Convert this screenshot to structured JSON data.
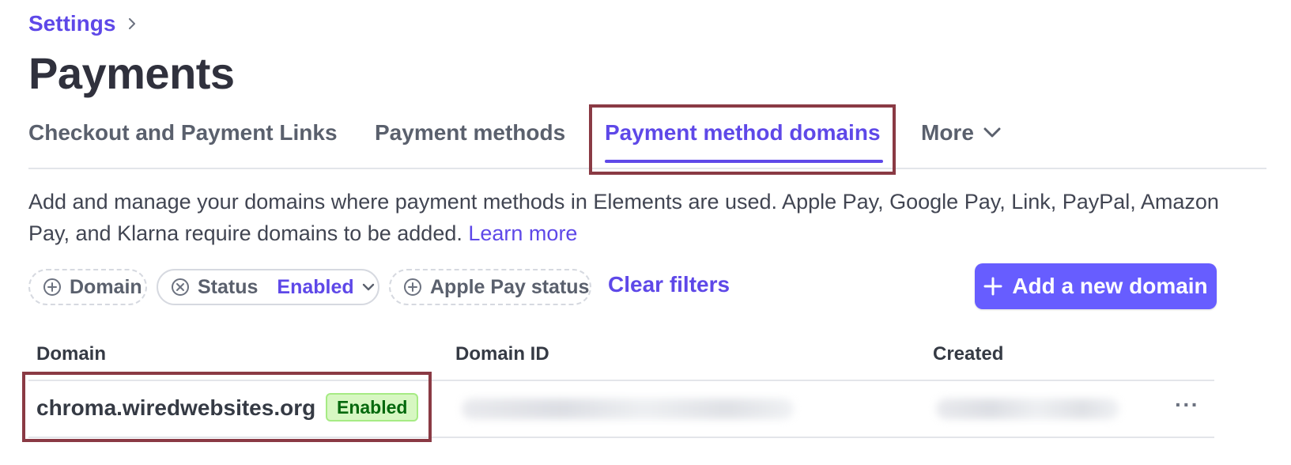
{
  "breadcrumb": {
    "parent": "Settings"
  },
  "page": {
    "title": "Payments"
  },
  "tabs": [
    {
      "label": "Checkout and Payment Links"
    },
    {
      "label": "Payment methods"
    },
    {
      "label": "Payment method domains",
      "active": true
    },
    {
      "label": "More"
    }
  ],
  "description": {
    "text": "Add and manage your domains where payment methods in Elements are used. Apple Pay, Google Pay, Link, PayPal, Amazon Pay, and Klarna require domains to be added.",
    "link": "Learn more"
  },
  "filters": {
    "domain": "Domain",
    "status": {
      "label": "Status",
      "value": "Enabled"
    },
    "apple_pay": "Apple Pay status",
    "clear": "Clear filters"
  },
  "actions": {
    "add_domain": "Add a new domain"
  },
  "table": {
    "columns": [
      "Domain",
      "Domain ID",
      "Created"
    ],
    "rows": [
      {
        "domain": "chroma.wiredwebsites.org",
        "status": "Enabled",
        "menu": "···"
      }
    ]
  },
  "colors": {
    "accent": "#5e48e8",
    "button": "#675dff",
    "highlight": "#8a3a44",
    "badge_bg": "#d7f7c2",
    "badge_text": "#05690d"
  }
}
